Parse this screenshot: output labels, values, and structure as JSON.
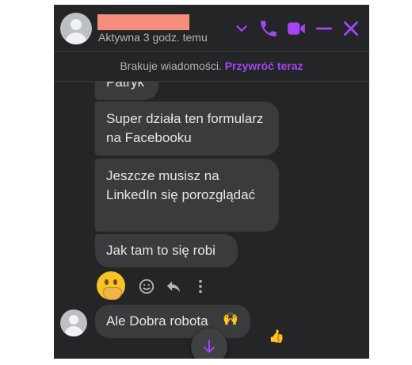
{
  "header": {
    "status": "Aktywna 3 godz. temu",
    "icons": [
      "chevron-down-icon",
      "phone-icon",
      "video-camera-icon",
      "minimize-icon",
      "close-icon"
    ],
    "accent_color": "#a545f7"
  },
  "banner": {
    "text": "Brakuje wiadomości.",
    "link": "Przywróć teraz"
  },
  "messages": [
    {
      "text": "Patryk"
    },
    {
      "text": "Super działa ten formularz na Facebooku"
    },
    {
      "text": "Jeszcze musisz na LinkedIn się porozglądać"
    },
    {
      "text": "Jak tam to się robi"
    },
    {
      "text": "Ale Dobra robota",
      "emoji_1": "🙌",
      "emoji_2": "👍"
    }
  ],
  "reaction_bar": {
    "emoji": "face-with-hand-over-mouth",
    "icons": [
      "smiley-icon",
      "reply-icon",
      "more-vertical-icon"
    ]
  }
}
